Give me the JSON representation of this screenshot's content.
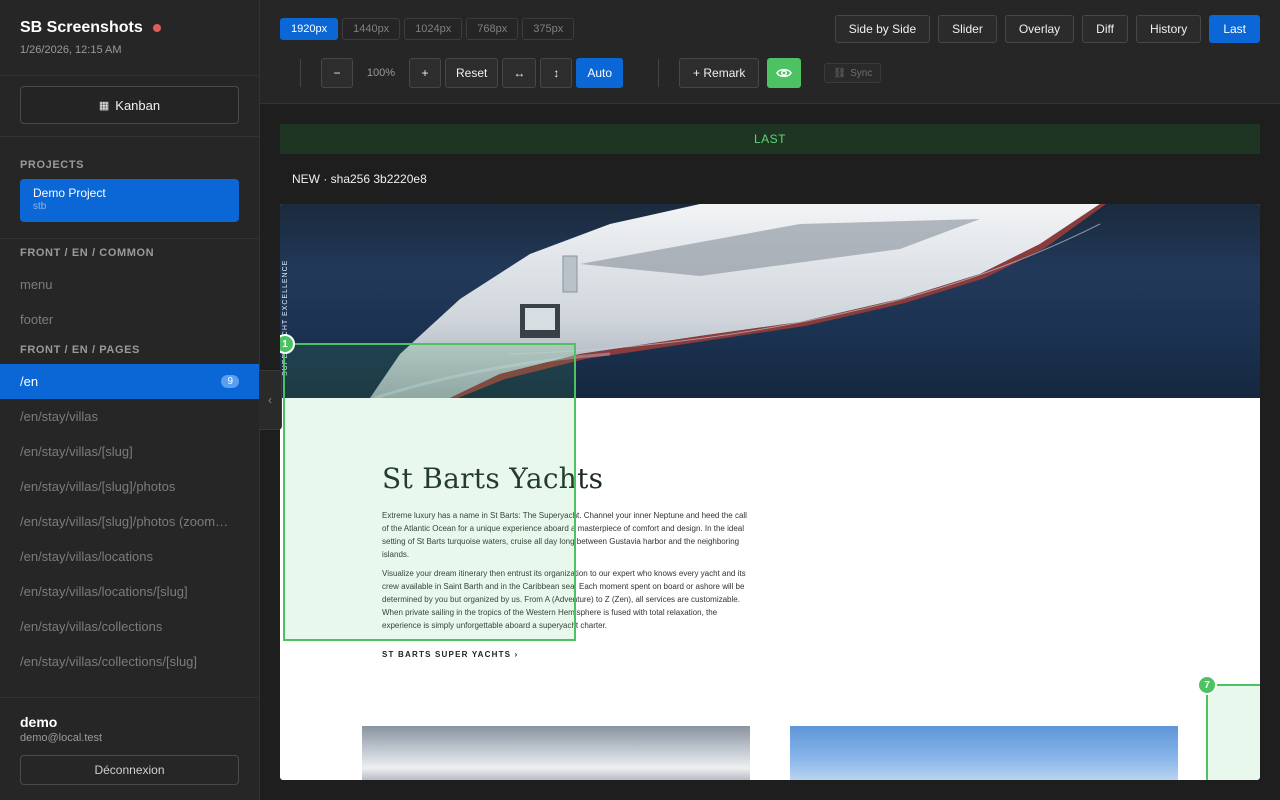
{
  "sidebar": {
    "app_title": "SB Screenshots",
    "date": "1/26/2026, 12:15 AM",
    "kanban_label": "Kanban",
    "projects_heading": "PROJECTS",
    "project": {
      "name": "Demo Project",
      "slug": "stb"
    },
    "groups": [
      {
        "heading": "FRONT / EN / COMMON",
        "items": [
          {
            "label": "menu"
          },
          {
            "label": "footer"
          }
        ]
      },
      {
        "heading": "FRONT / EN / PAGES",
        "items": [
          {
            "label": "/en",
            "badge": "9",
            "active": true
          },
          {
            "label": "/en/stay/villas"
          },
          {
            "label": "/en/stay/villas/[slug]"
          },
          {
            "label": "/en/stay/villas/[slug]/photos"
          },
          {
            "label": "/en/stay/villas/[slug]/photos (zoom…"
          },
          {
            "label": "/en/stay/villas/locations"
          },
          {
            "label": "/en/stay/villas/locations/[slug]"
          },
          {
            "label": "/en/stay/villas/collections"
          },
          {
            "label": "/en/stay/villas/collections/[slug]"
          }
        ]
      }
    ],
    "user": {
      "name": "demo",
      "email": "demo@local.test"
    },
    "logout_label": "Déconnexion"
  },
  "toolbar": {
    "resolutions": [
      "1920px",
      "1440px",
      "1024px",
      "768px",
      "375px"
    ],
    "active_resolution": "1920px",
    "modes": [
      "Side by Side",
      "Slider",
      "Overlay",
      "Diff",
      "History",
      "Last"
    ],
    "active_mode": "Last",
    "zoom_out": "−",
    "zoom_value": "100%",
    "zoom_in": "+",
    "reset": "Reset",
    "fit_width": "↔",
    "fit_height": "↕",
    "auto": "Auto",
    "remark": "+ Remark",
    "sync": "Sync"
  },
  "content": {
    "banner": "LAST",
    "version_label": "NEW · sha256 3b2220e8",
    "page": {
      "vertical_text": "SUPERYACHT EXCELLENCE",
      "title": "St Barts Yachts",
      "para1": "Extreme luxury has a name in St Barts: The Superyacht. Channel your inner Neptune and heed the call of the Atlantic Ocean for a unique experience aboard a masterpiece of comfort and design. In the ideal setting of St Barts turquoise waters, cruise all day long between Gustavia harbor and the neighboring islands.",
      "para2": "Visualize your dream itinerary then entrust its organization to our expert who knows every yacht and its crew available in Saint Barth and in the Caribbean sea. Each moment spent on board or ashore will be determined by you but organized by us. From A (Adventure) to Z (Zen), all services are customizable. When private sailing in the tropics of the Western Hemisphere is fused with total relaxation, the experience is simply unforgettable aboard a superyacht charter.",
      "cta": "ST BARTS SUPER YACHTS  ›"
    },
    "remarks": [
      {
        "number": "1"
      },
      {
        "number": "7"
      }
    ]
  },
  "colors": {
    "accent": "#0b66d6",
    "remark": "#4cc263",
    "status_dot": "#e05b5b"
  }
}
